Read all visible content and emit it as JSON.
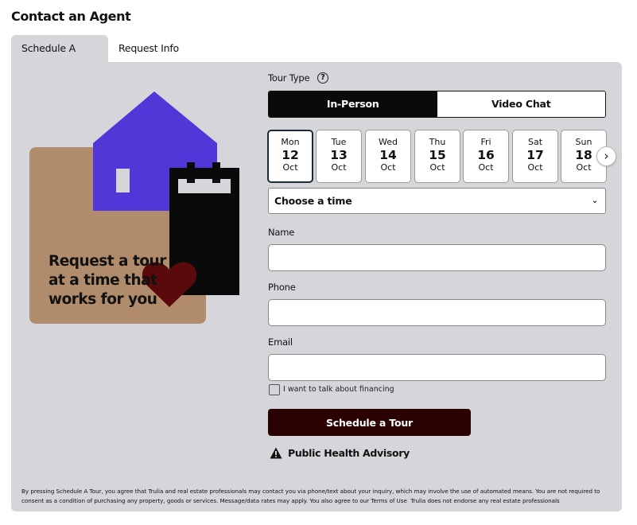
{
  "header": {
    "title": "Contact an Agent"
  },
  "tabs": [
    {
      "label": "Schedule A Tour"
    },
    {
      "label": "Request Info"
    }
  ],
  "illustration": {
    "caption_lines": [
      "Request a tour",
      "at a time that",
      "works for you"
    ],
    "colors": {
      "box": "#b08c6c",
      "house": "#5136d8",
      "calendar": "#0a0a0a",
      "heart": "#5a0a0a"
    }
  },
  "tour_type": {
    "label": "Tour Type",
    "help_icon": "question-circle-icon",
    "options": [
      "In-Person",
      "Video Chat"
    ],
    "selected": "In-Person"
  },
  "dates": [
    {
      "weekday": "Mon",
      "day": "12",
      "month": "Oct",
      "selected": true
    },
    {
      "weekday": "Tue",
      "day": "13",
      "month": "Oct"
    },
    {
      "weekday": "Wed",
      "day": "14",
      "month": "Oct"
    },
    {
      "weekday": "Thu",
      "day": "15",
      "month": "Oct"
    },
    {
      "weekday": "Fri",
      "day": "16",
      "month": "Oct"
    },
    {
      "weekday": "Sat",
      "day": "17",
      "month": "Oct"
    },
    {
      "weekday": "Sun",
      "day": "18",
      "month": "Oct"
    }
  ],
  "date_next_icon": "chevron-right-icon",
  "time_select": {
    "value": "Choose a time",
    "icon": "chevron-down-icon"
  },
  "form": {
    "name_label": "Name",
    "phone_label": "Phone",
    "email_label": "Email",
    "name_value": "",
    "phone_value": "",
    "email_value": ""
  },
  "financing": {
    "label": "I want to talk about financing",
    "checked": false
  },
  "cta": {
    "label": "Schedule a Tour",
    "color": "#2a0202"
  },
  "advisory": {
    "icon": "warning-triangle-icon",
    "label": "Public Health Advisory"
  },
  "legal": {
    "text": "By pressing Schedule A Tour, you agree that Trulia and real estate professionals may contact you via phone/text about your inquiry, which may involve the use of automated means. You are not required to consent as a condition of purchasing any property, goods or services. Message/data rates may apply. You also agree to our",
    "terms_link": "Terms of Use",
    "suffix": "Trulia does not endorse any real estate professionals"
  }
}
